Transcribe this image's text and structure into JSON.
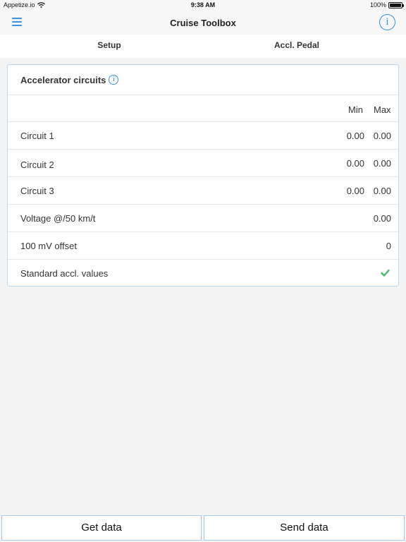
{
  "status_bar": {
    "carrier": "Appetize.io",
    "time": "9:38 AM",
    "battery": "100%",
    "icons": [
      "wifi-icon",
      "battery-icon"
    ]
  },
  "nav": {
    "title": "Cruise Toolbox",
    "menu_icon": "hamburger-menu-icon",
    "info_icon": "info-icon",
    "info_glyph": "i"
  },
  "tabs": [
    {
      "label": "Setup",
      "selected": false
    },
    {
      "label": "Accl. Pedal",
      "selected": true
    }
  ],
  "card": {
    "title": "Accelerator circuits",
    "info_glyph": "i",
    "columns": {
      "min": "Min",
      "max": "Max"
    },
    "rows": [
      {
        "label": "Circuit 1",
        "min": "0.00",
        "max": "0.00"
      },
      {
        "label": "Circuit 2",
        "min": "0.00",
        "max": "0.00"
      },
      {
        "label": "Circuit 3",
        "min": "0.00",
        "max": "0.00"
      },
      {
        "label": "Voltage @/50 km/t",
        "value": "0.00"
      },
      {
        "label": "100 mV offset",
        "value": "0"
      },
      {
        "label": "Standard accl. values",
        "checked": true
      }
    ]
  },
  "footer": {
    "get_label": "Get data",
    "send_label": "Send data"
  },
  "colors": {
    "accent": "#3a8ee6",
    "tab_indicator": "#5aa8dc",
    "check": "#4cb86b",
    "border": "#b8d4ee"
  }
}
